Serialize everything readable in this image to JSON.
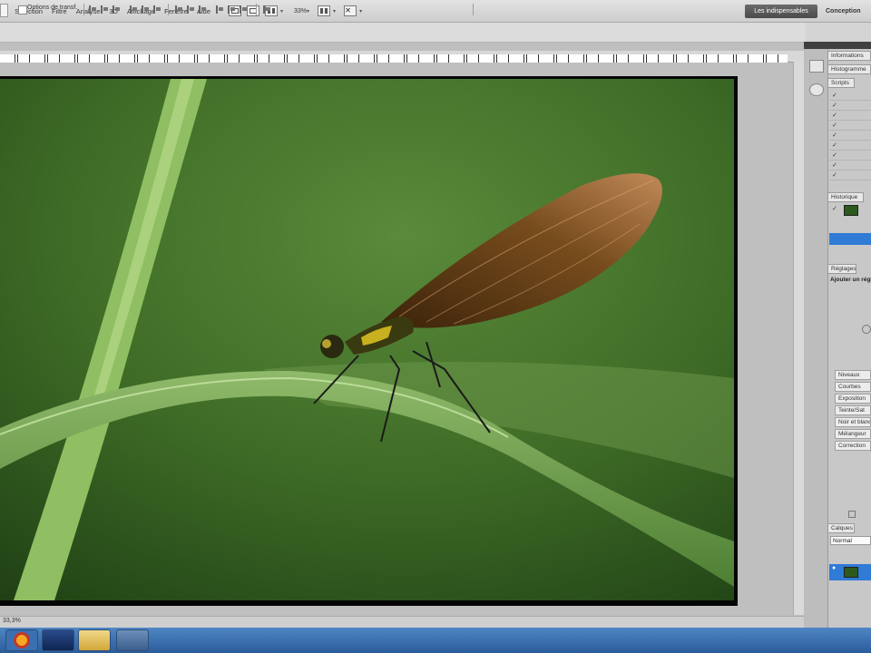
{
  "menubar": {
    "items": [
      "e",
      "Sélection",
      "Filtre",
      "Analyse",
      "3D",
      "Affichage",
      "Fenêtre",
      "Aide"
    ],
    "zoom": "33%",
    "workspaces": {
      "essentials": "Les indispensables",
      "design": "Conception"
    }
  },
  "options_bar": {
    "transform_controls_label": "Options de transf."
  },
  "right_panel": {
    "tabs": {
      "info": "Informations",
      "histogram": "Histogramme",
      "layers": "Scripts",
      "history": "Historique",
      "adjustments": "Réglages",
      "adjust_title": "Ajouter un réglage",
      "layers_bottom": "Calques",
      "blend_mode": "Normal"
    },
    "adjustment_presets": [
      "Niveaux",
      "Courbes",
      "Exposition",
      "Teinte/Sat",
      "Noir et blanc",
      "Mélangeur",
      "Correction"
    ],
    "layer_checks": [
      "✓",
      "✓",
      "✓",
      "✓",
      "✓",
      "✓",
      "✓",
      "✓",
      "✓"
    ]
  },
  "status": {
    "zoom": "33,3%"
  },
  "colors": {
    "menubar": "#d8d8d8",
    "panel": "#c8c8c8",
    "selection_blue": "#2f7bd6",
    "taskbar": "#3d6fae",
    "photo_background": "#3a6a26"
  },
  "icons": {
    "taskbar": [
      "firefox-icon",
      "photoshop-icon",
      "folder-icon",
      "media-player-icon"
    ]
  }
}
